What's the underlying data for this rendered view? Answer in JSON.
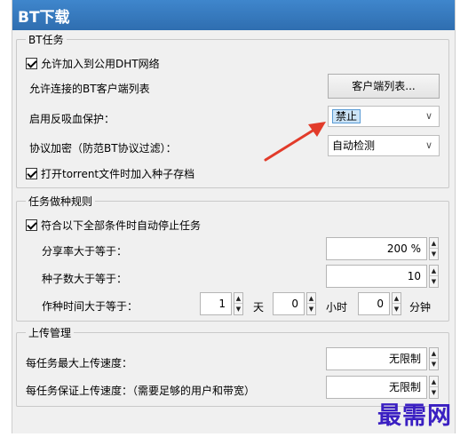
{
  "window": {
    "title": "BT下载"
  },
  "bt_tasks": {
    "title": "BT任务",
    "dht_checkbox_label": "允许加入到公用DHT网络",
    "client_list_label": "允许连接的BT客户端列表",
    "client_list_button": "客户端列表...",
    "anti_leech_label": "启用反吸血保护：",
    "anti_leech_value": "禁止",
    "encryption_label": "协议加密（防范BT协议过滤）：",
    "encryption_value": "自动检测",
    "seed_checkbox_label": "打开torrent文件时加入种子存档"
  },
  "seeding_rules": {
    "title": "任务做种规则",
    "stop_checkbox_label": "符合以下全部条件时自动停止任务",
    "ratio_label": "分享率大于等于：",
    "ratio_value": "200 %",
    "seeds_label": "种子数大于等于：",
    "seeds_value": "10",
    "time_label": "作种时间大于等于：",
    "days_value": "1",
    "days_unit": "天",
    "hours_value": "0",
    "hours_unit": "小时",
    "minutes_value": "0",
    "minutes_unit": "分钟"
  },
  "upload": {
    "title": "上传管理",
    "max_speed_label": "每任务最大上传速度：",
    "max_speed_value": "无限制",
    "guaranteed_speed_label": "每任务保证上传速度：（需要足够的用户和带宽）",
    "guaranteed_speed_value": "无限制"
  },
  "watermark": "最需网",
  "colors": {
    "titlebar": "#3a7bc8",
    "annotation_arrow": "#e23b2a",
    "watermark": "#3a1fc2",
    "selection": "#cce4f7"
  }
}
